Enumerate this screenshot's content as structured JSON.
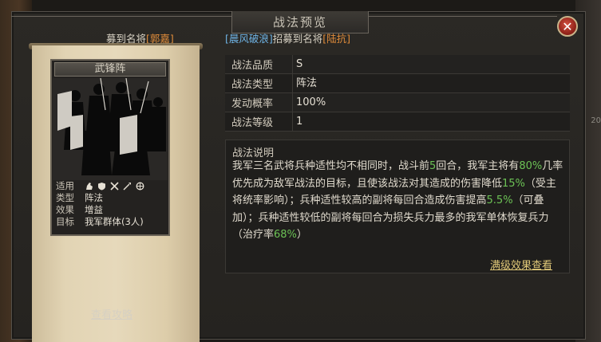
{
  "dialog": {
    "title": "战法预览",
    "close_label": "✕"
  },
  "notices": [
    {
      "prefix": "募到名将",
      "name": "[郭嘉]"
    },
    {
      "user": "[晨风破浪]",
      "middle": "招募到名将",
      "name": "[陆抗]"
    }
  ],
  "side_hint": "20",
  "card": {
    "name": "武锋阵",
    "rows": [
      {
        "label": "适用",
        "icons": [
          "cavalry-icon",
          "shield-icon",
          "crossed-swords-icon",
          "spear-icon",
          "wheel-icon"
        ]
      },
      {
        "label": "类型",
        "value": "阵法"
      },
      {
        "label": "效果",
        "value": "增益"
      },
      {
        "label": "目标",
        "value": "我军群体(3人)"
      }
    ],
    "guide_link": "查看攻略"
  },
  "attributes": [
    {
      "label": "战法品质",
      "value": "S"
    },
    {
      "label": "战法类型",
      "value": "阵法"
    },
    {
      "label": "发动概率",
      "value": "100%"
    },
    {
      "label": "战法等级",
      "value": "1"
    }
  ],
  "description": {
    "title": "战法说明",
    "segments": [
      {
        "text": "我军三名武将兵种适性均不相同时，战斗前"
      },
      {
        "text": "5",
        "highlight": true
      },
      {
        "text": "回合，我军主将有"
      },
      {
        "text": "80%",
        "highlight": true
      },
      {
        "text": "几率优先成为敌军战法的目标，且使该战法对其造成的伤害降低"
      },
      {
        "text": "15%",
        "highlight": true
      },
      {
        "text": "（受主将统率影响）；兵种适性较高的副将每回合造成伤害提高"
      },
      {
        "text": "5.5%",
        "highlight": true
      },
      {
        "text": "（可叠加）；兵种适性较低的副将每回合为损失兵力最多的我军单体恢复兵力（治疗率"
      },
      {
        "text": "68%",
        "highlight": true
      },
      {
        "text": "）"
      }
    ],
    "full_effect_link": "满级效果查看"
  },
  "colors": {
    "highlight_green": "#6cc255",
    "name_orange": "#e08c3a",
    "user_blue": "#6fb4e6",
    "link_gold": "#e0c878"
  }
}
